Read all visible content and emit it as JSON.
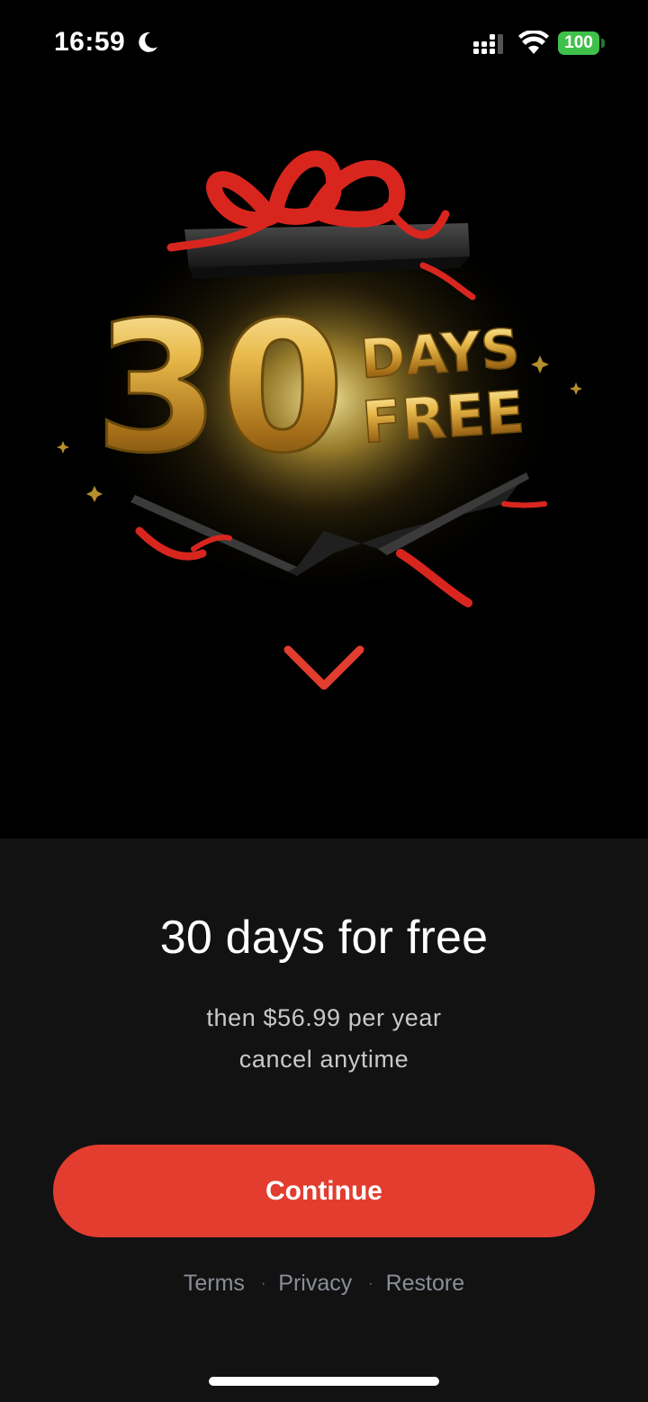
{
  "status_bar": {
    "time": "16:59",
    "battery_level": "100",
    "icons": [
      "moon-icon",
      "cellular-signal-icon",
      "wifi-icon",
      "battery-icon"
    ]
  },
  "promo": {
    "number": "30",
    "word1": "DAYS",
    "word2": "FREE",
    "illustration": "open-gift-box-with-gold-balloons",
    "chevron_icon": "chevron-down-icon"
  },
  "offer": {
    "title": "30 days for free",
    "price_line": "then $56.99 per year",
    "cancel_line": "cancel anytime"
  },
  "cta": {
    "continue_label": "Continue"
  },
  "legal": {
    "terms": "Terms",
    "privacy": "Privacy",
    "restore": "Restore",
    "separator": "·"
  },
  "colors": {
    "accent": "#e23d2f",
    "ribbon": "#d8261f",
    "gold": "#e0b042",
    "sheet_background": "#121212",
    "hero_background": "#000000",
    "battery": "#3fc04a"
  }
}
